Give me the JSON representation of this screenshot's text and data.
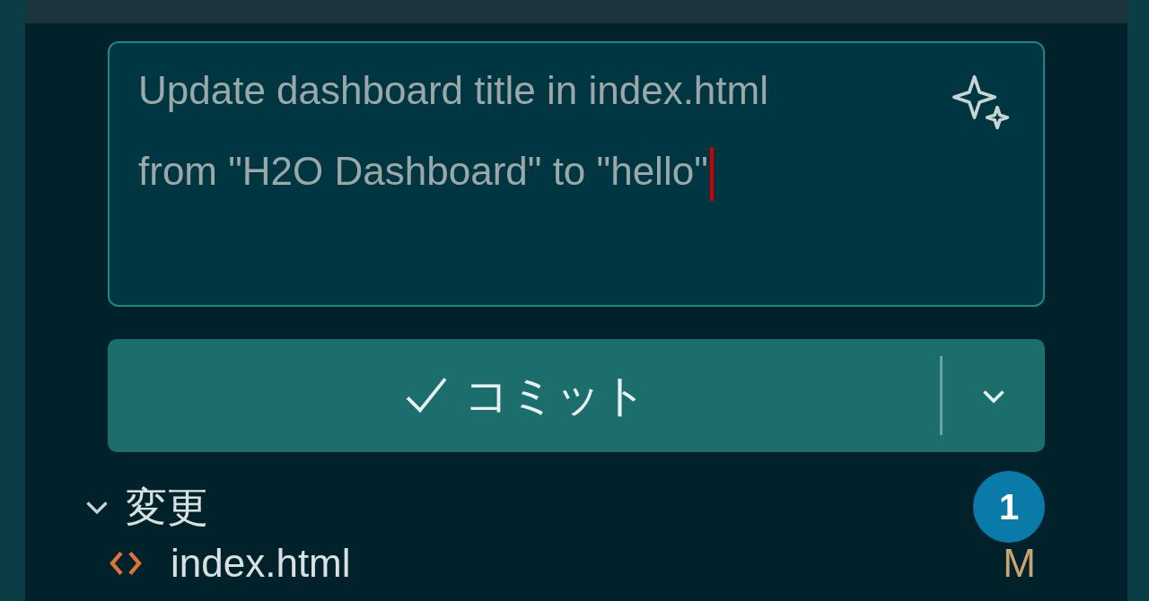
{
  "commit_message": {
    "value": "Update dashboard title in index.html from \"H2O Dashboard\" to \"hello\""
  },
  "commit_button": {
    "label": "コミット"
  },
  "changes": {
    "label": "変更",
    "expanded": true,
    "count": "1",
    "files": [
      {
        "name": "index.html",
        "status": "M"
      }
    ]
  }
}
